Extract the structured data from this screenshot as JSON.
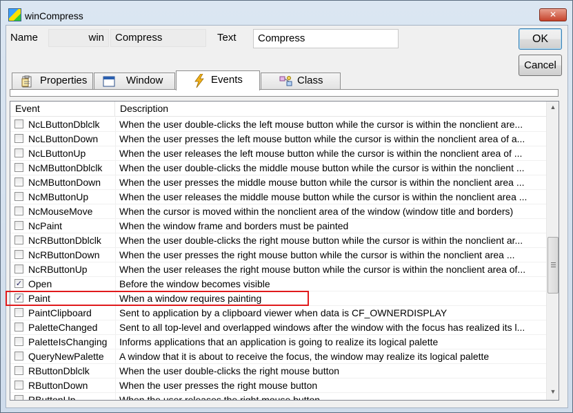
{
  "window": {
    "title": "winCompress",
    "close_glyph": "✕"
  },
  "fields": {
    "name_label": "Name",
    "name_prefix": "win",
    "name_value": "Compress",
    "text_label": "Text",
    "text_value": "Compress"
  },
  "buttons": {
    "ok": "OK",
    "cancel": "Cancel"
  },
  "tabs": [
    {
      "label": "Properties",
      "icon": "properties-icon"
    },
    {
      "label": "Window",
      "icon": "window-icon"
    },
    {
      "label": "Events",
      "icon": "lightning-icon",
      "active": true
    },
    {
      "label": "Class",
      "icon": "class-icon"
    }
  ],
  "grid": {
    "columns": [
      "Event",
      "Description"
    ],
    "rows": [
      {
        "event": "NcLButtonDblclk",
        "checked": false,
        "description": "When the user double-clicks the left mouse button while the cursor is within the nonclient are..."
      },
      {
        "event": "NcLButtonDown",
        "checked": false,
        "description": "When the user presses the left mouse button while the cursor is within the nonclient area of a..."
      },
      {
        "event": "NcLButtonUp",
        "checked": false,
        "description": "When the user releases the left mouse button while the cursor is within the nonclient area of ..."
      },
      {
        "event": "NcMButtonDblclk",
        "checked": false,
        "description": "When the user double-clicks the middle mouse button while the cursor is within the nonclient ..."
      },
      {
        "event": "NcMButtonDown",
        "checked": false,
        "description": "When the user presses the middle mouse button while the cursor is within the nonclient area ..."
      },
      {
        "event": "NcMButtonUp",
        "checked": false,
        "description": "When the user releases the middle mouse button while the cursor is within the nonclient area ..."
      },
      {
        "event": "NcMouseMove",
        "checked": false,
        "description": "When the cursor is moved within the nonclient area of the window (window title and borders)"
      },
      {
        "event": "NcPaint",
        "checked": false,
        "description": "When the window frame and borders must be painted"
      },
      {
        "event": "NcRButtonDblclk",
        "checked": false,
        "description": "When the user double-clicks the right mouse button while the cursor is within the nonclient ar..."
      },
      {
        "event": "NcRButtonDown",
        "checked": false,
        "description": "When the user presses the right mouse button while the cursor is within the nonclient area ..."
      },
      {
        "event": "NcRButtonUp",
        "checked": false,
        "description": "When the user releases the right mouse button while the cursor is within the nonclient area of..."
      },
      {
        "event": "Open",
        "checked": true,
        "description": "Before the window becomes visible"
      },
      {
        "event": "Paint",
        "checked": true,
        "description": "When a window requires painting"
      },
      {
        "event": "PaintClipboard",
        "checked": false,
        "description": "Sent to application by a clipboard viewer when data is CF_OWNERDISPLAY"
      },
      {
        "event": "PaletteChanged",
        "checked": false,
        "description": "Sent to all top-level and overlapped windows after the window with the focus has realized its l..."
      },
      {
        "event": "PaletteIsChanging",
        "checked": false,
        "description": "Informs applications that an application is going to realize its logical palette"
      },
      {
        "event": "QueryNewPalette",
        "checked": false,
        "description": "A window that it is about to receive the focus, the window may realize its logical palette"
      },
      {
        "event": "RButtonDblclk",
        "checked": false,
        "description": "When the user double-clicks the right mouse button"
      },
      {
        "event": "RButtonDown",
        "checked": false,
        "description": "When the user presses the right mouse button"
      },
      {
        "event": "RButtonUp",
        "checked": false,
        "description": "When the user releases the right mouse button"
      }
    ]
  },
  "check_glyph": "✓",
  "scroll": {
    "up_glyph": "▲",
    "down_glyph": "▼"
  },
  "colors": {
    "highlight_border": "#e0191b",
    "close_button": "#c6432b"
  }
}
